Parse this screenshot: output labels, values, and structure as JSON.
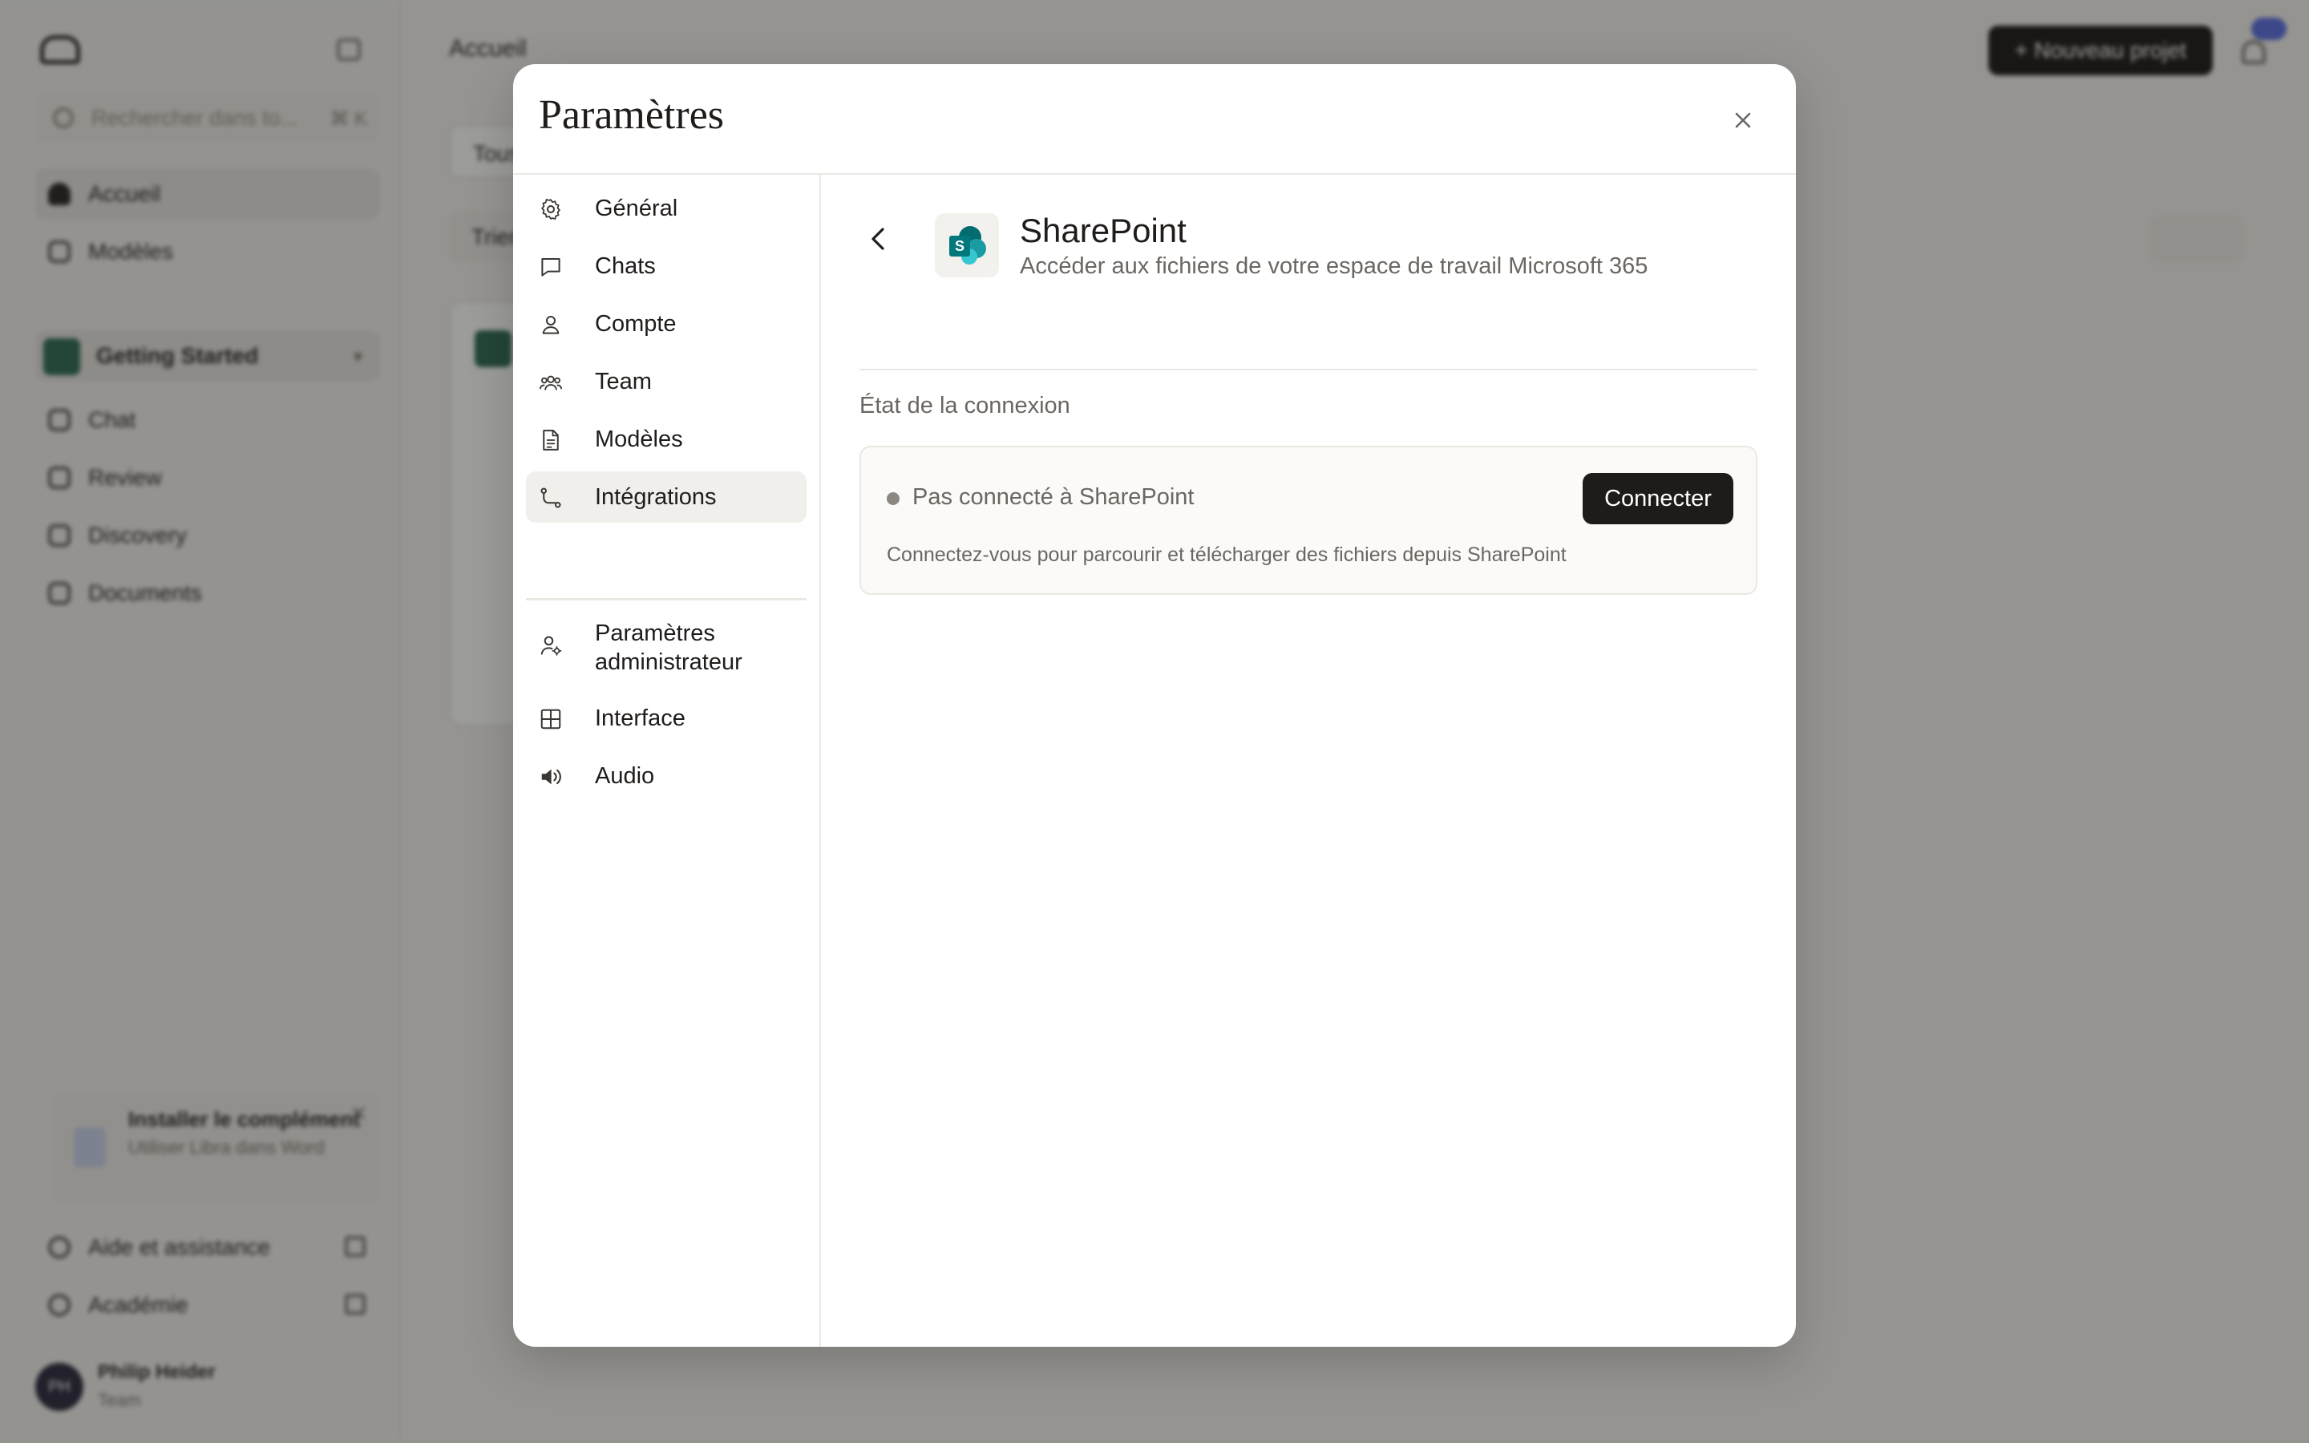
{
  "background": {
    "sidebar": {
      "search_placeholder": "Rechercher dans to...",
      "search_shortcut": "⌘ K",
      "items": [
        {
          "label": "Accueil"
        },
        {
          "label": "Modèles"
        }
      ],
      "project": {
        "label": "Getting Started"
      },
      "project_items": [
        {
          "label": "Chat"
        },
        {
          "label": "Review"
        },
        {
          "label": "Discovery"
        },
        {
          "label": "Documents"
        }
      ],
      "addin": {
        "title": "Installer le complément",
        "subtitle": "Utiliser Libra dans Word"
      },
      "footer_items": [
        {
          "label": "Aide et assistance"
        },
        {
          "label": "Académie"
        }
      ],
      "user": {
        "initials": "PH",
        "name": "Philip Heider",
        "role": "Team"
      }
    },
    "main": {
      "title": "Accueil",
      "new_project_label": "+ Nouveau projet",
      "pill_1": "Tous",
      "pill_2": "Trier"
    }
  },
  "modal": {
    "title": "Paramètres",
    "nav": [
      {
        "label": "Général",
        "icon": "gear-icon"
      },
      {
        "label": "Chats",
        "icon": "chat-bubble-icon"
      },
      {
        "label": "Compte",
        "icon": "user-icon"
      },
      {
        "label": "Team",
        "icon": "team-icon"
      },
      {
        "label": "Modèles",
        "icon": "document-icon"
      },
      {
        "label": "Intégrations",
        "icon": "integration-icon",
        "active": true
      },
      {
        "label": "Paramètres administrateur",
        "icon": "admin-user-icon"
      },
      {
        "label": "Interface",
        "icon": "grid-icon"
      },
      {
        "label": "Audio",
        "icon": "speaker-icon"
      }
    ],
    "integration": {
      "name": "SharePoint",
      "description": "Accéder aux fichiers de votre espace de travail Microsoft 365",
      "icon": "sharepoint-icon",
      "section_label": "État de la connexion",
      "status_text": "Pas connecté à SharePoint",
      "status_color": "#8c8781",
      "connect_label": "Connecter",
      "hint": "Connectez-vous pour parcourir et télécharger des fichiers depuis SharePoint"
    }
  }
}
